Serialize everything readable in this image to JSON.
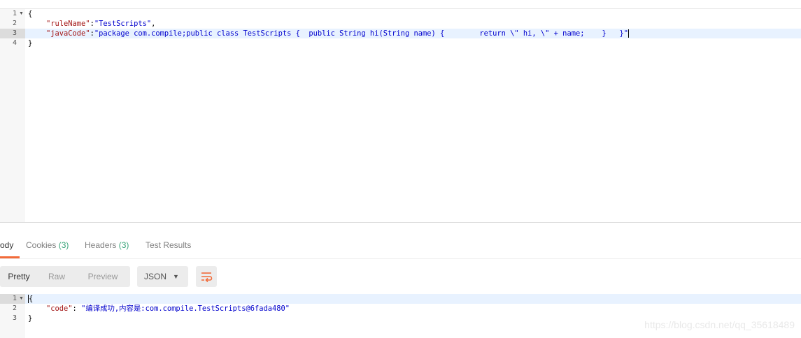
{
  "request_body": {
    "lines": [
      {
        "num": "1",
        "fold": true,
        "text": "{"
      },
      {
        "num": "2",
        "fold": false,
        "key": "\"ruleName\"",
        "sep": ":",
        "value": "\"TestScripts\"",
        "tail": ","
      },
      {
        "num": "3",
        "fold": false,
        "key": "\"javaCode\"",
        "sep": ":",
        "value": "\"package com.compile;public class TestScripts {  public String hi(String name) {        return \\\" hi, \\\" + name;    }   }\"",
        "tail": ""
      },
      {
        "num": "4",
        "fold": false,
        "text": "}"
      }
    ]
  },
  "response_tabs": {
    "body": "ody",
    "cookies": "Cookies",
    "cookies_count": "(3)",
    "headers": "Headers",
    "headers_count": "(3)",
    "test_results": "Test Results"
  },
  "view_modes": {
    "pretty": "Pretty",
    "raw": "Raw",
    "preview": "Preview"
  },
  "format_select": {
    "selected": "JSON"
  },
  "response_body": {
    "lines": [
      {
        "num": "1",
        "text": "{"
      },
      {
        "num": "2",
        "key": "\"code\"",
        "sep": ": ",
        "value": "\"编译成功,内容是:com.compile.TestScripts@6fada480\""
      },
      {
        "num": "3",
        "text": "}"
      }
    ]
  },
  "watermark": "https://blog.csdn.net/qq_35618489",
  "colors": {
    "accent": "#f26b3a",
    "count": "#3aa57a",
    "key": "#a31515",
    "string": "#0000cd"
  }
}
